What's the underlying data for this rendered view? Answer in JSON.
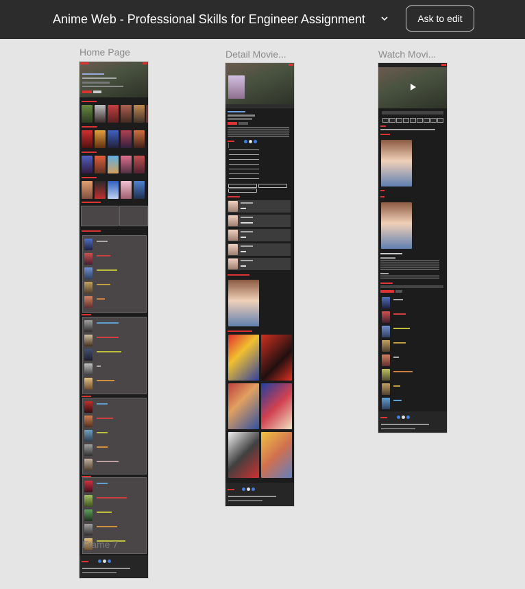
{
  "header": {
    "title": "Anime Web - Professional Skills for Engineer Assignment",
    "edit_button": "Ask to edit"
  },
  "frames": [
    {
      "label": "Home Page"
    },
    {
      "label": "Detail Movie..."
    },
    {
      "label": "Watch Movi..."
    }
  ],
  "home": {
    "overlay_text": "Frame 7"
  },
  "colors": {
    "topbar": "#2c2c2c",
    "canvas": "#e5e5e5",
    "frame_bg": "#1c1c1c",
    "accent_red": "#e04040",
    "panel": "#4a4546"
  }
}
